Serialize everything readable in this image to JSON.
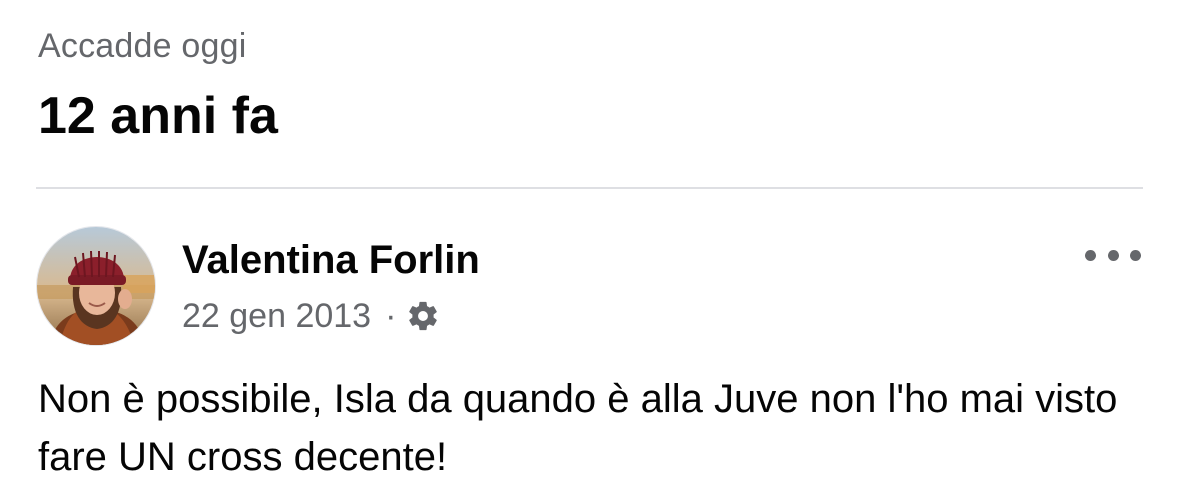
{
  "memory": {
    "section_label": "Accadde oggi",
    "years_ago": "12 anni fa"
  },
  "post": {
    "author_name": "Valentina Forlin",
    "date": "22 gen 2013",
    "separator": "·",
    "privacy_icon": "gear-icon",
    "more_icon": "more-options-icon",
    "text": "Non è possibile, Isla da quando è alla Juve non l'ho mai visto fare UN cross decente!"
  },
  "colors": {
    "primary_text": "#050505",
    "secondary_text": "#65676b",
    "divider": "#dedfe3",
    "background": "#ffffff"
  }
}
